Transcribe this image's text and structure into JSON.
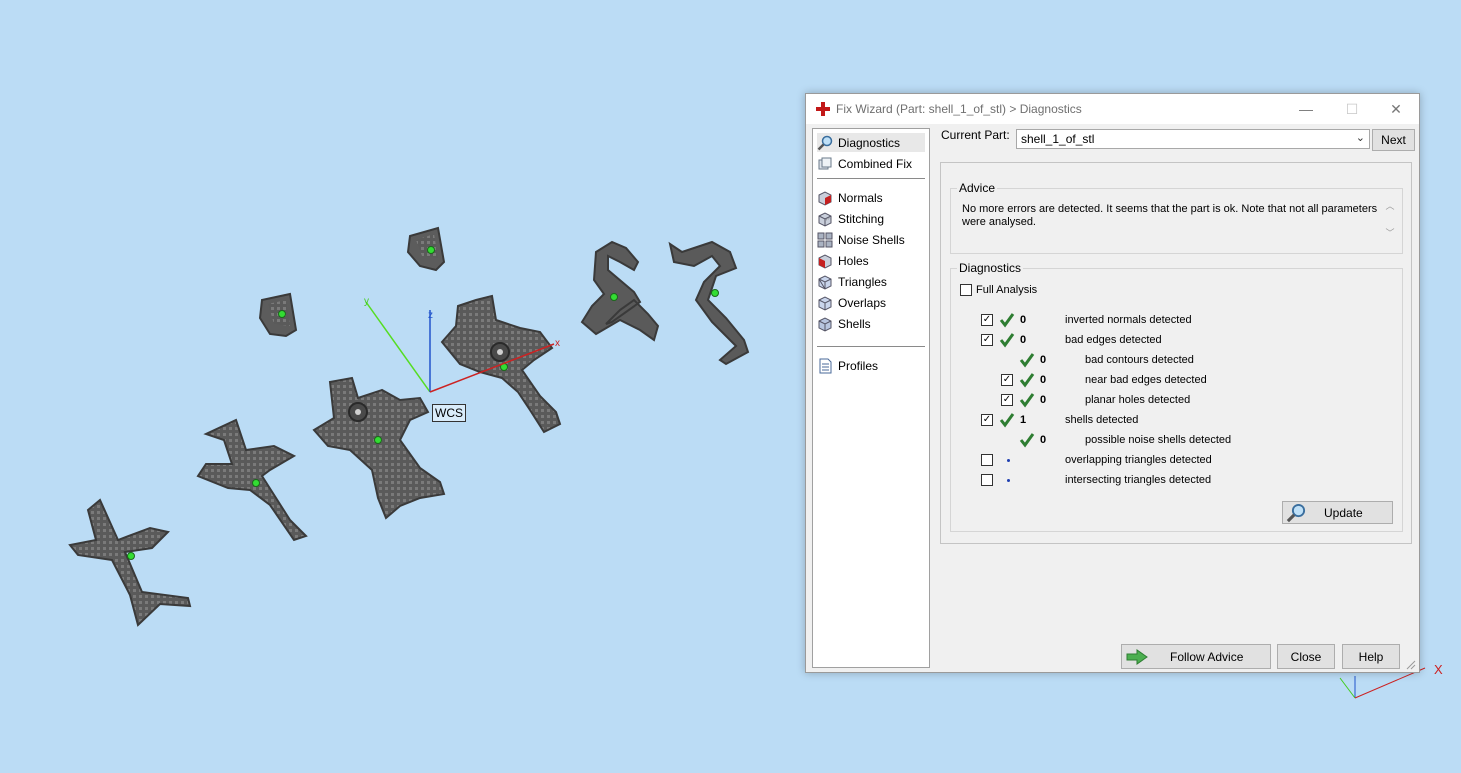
{
  "viewport": {
    "wcs_label": "WCS",
    "axis_x": "x",
    "axis_y": "y",
    "axis_z": "z",
    "corner_axis_x": "X"
  },
  "window": {
    "title": "Fix Wizard (Part: shell_1_of_stl) > Diagnostics",
    "minimize_glyph": "—",
    "maximize_glyph": "☐",
    "close_glyph": "✕"
  },
  "nav": {
    "items": [
      {
        "label": "Diagnostics",
        "icon": "magnifier-icon",
        "selected": true
      },
      {
        "label": "Combined Fix",
        "icon": "cubes-icon"
      },
      {
        "label": "Normals",
        "icon": "normals-cube-icon"
      },
      {
        "label": "Stitching",
        "icon": "stitching-cube-icon"
      },
      {
        "label": "Noise Shells",
        "icon": "noise-shells-icon"
      },
      {
        "label": "Holes",
        "icon": "holes-cube-icon"
      },
      {
        "label": "Triangles",
        "icon": "triangles-cube-icon"
      },
      {
        "label": "Overlaps",
        "icon": "overlaps-cube-icon"
      },
      {
        "label": "Shells",
        "icon": "shells-cube-icon"
      },
      {
        "label": "Profiles",
        "icon": "document-icon"
      }
    ]
  },
  "current_part": {
    "label": "Current Part:",
    "value": "shell_1_of_stl",
    "next_label": "Next"
  },
  "advice": {
    "title": "Advice",
    "text": "No more errors are detected. It seems that the part is ok. Note that not all parameters were analysed.",
    "scroll_up": "︿",
    "scroll_down": "﹀"
  },
  "diagnostics": {
    "title": "Diagnostics",
    "full_analysis_label": "Full Analysis",
    "full_analysis_checked": false,
    "rows": [
      {
        "checkbox": true,
        "checked": true,
        "status": "ok",
        "count": "0",
        "label": "inverted normals detected"
      },
      {
        "checkbox": true,
        "checked": true,
        "status": "ok",
        "count": "0",
        "label": "bad edges detected"
      },
      {
        "checkbox": false,
        "status": "ok",
        "count": "0",
        "label": "bad contours detected"
      },
      {
        "checkbox": true,
        "checked": true,
        "status": "ok",
        "count": "0",
        "label": "near bad edges detected"
      },
      {
        "checkbox": true,
        "checked": true,
        "status": "ok",
        "count": "0",
        "label": "planar holes detected"
      },
      {
        "checkbox": true,
        "checked": true,
        "status": "ok",
        "count": "1",
        "label": "shells detected"
      },
      {
        "checkbox": false,
        "status": "ok",
        "count": "0",
        "label": "possible noise shells detected"
      },
      {
        "checkbox": true,
        "checked": false,
        "status": "pending",
        "count": "",
        "label": "overlapping triangles detected"
      },
      {
        "checkbox": true,
        "checked": false,
        "status": "pending",
        "count": "",
        "label": "intersecting triangles detected"
      }
    ],
    "update_label": "Update"
  },
  "footer": {
    "follow_advice_label": "Follow Advice",
    "close_label": "Close",
    "help_label": "Help"
  },
  "colors": {
    "background": "#bbdcf5",
    "ok_check": "#2e7d32",
    "pending_dot": "#1f3fb0",
    "x_axis": "#cc2222",
    "y_axis": "#44cc22",
    "z_axis": "#2255cc"
  }
}
